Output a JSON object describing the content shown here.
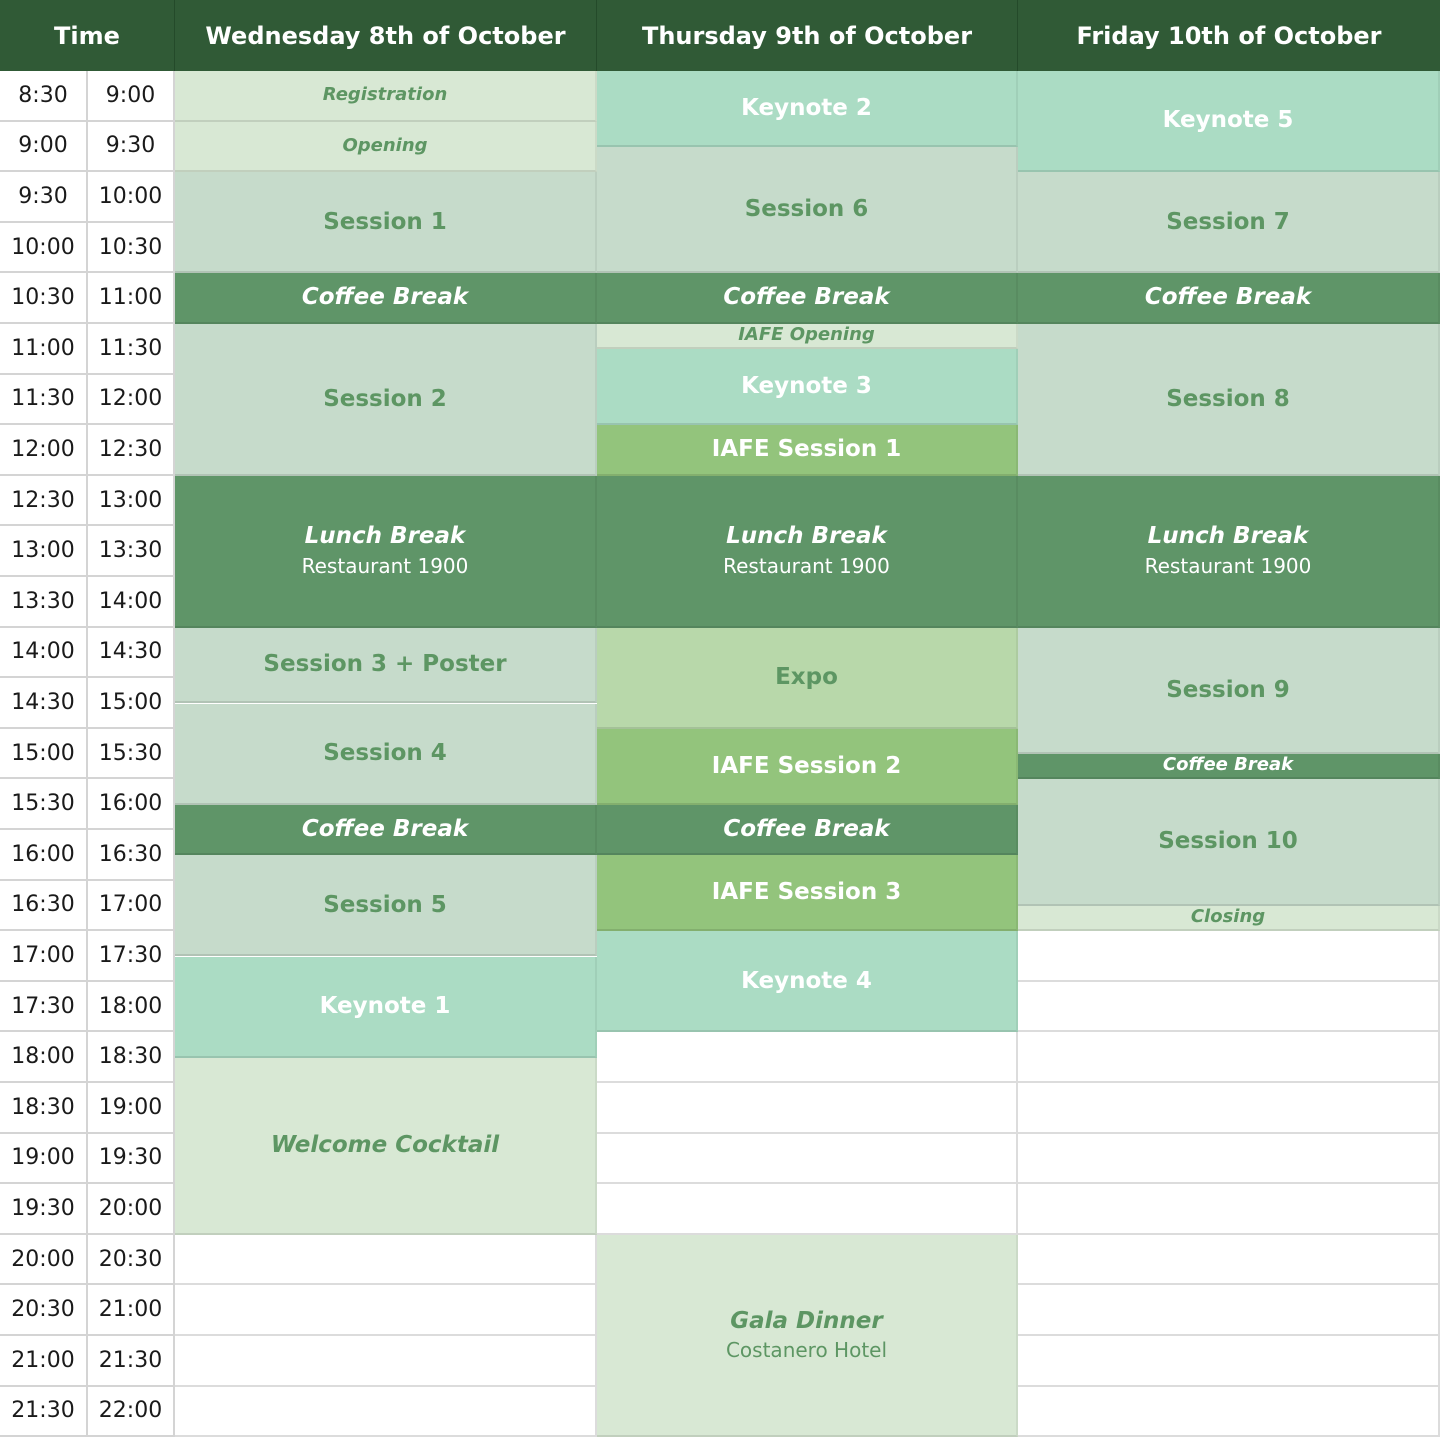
{
  "header": {
    "time_label": "Time",
    "days": [
      "Wednesday 8th of October",
      "Thursday 9th of October",
      "Friday 10th of October"
    ]
  },
  "time_slots": [
    [
      "8:30",
      "9:00"
    ],
    [
      "9:00",
      "9:30"
    ],
    [
      "9:30",
      "10:00"
    ],
    [
      "10:00",
      "10:30"
    ],
    [
      "10:30",
      "11:00"
    ],
    [
      "11:00",
      "11:30"
    ],
    [
      "11:30",
      "12:00"
    ],
    [
      "12:00",
      "12:30"
    ],
    [
      "12:30",
      "13:00"
    ],
    [
      "13:00",
      "13:30"
    ],
    [
      "13:30",
      "14:00"
    ],
    [
      "14:00",
      "14:30"
    ],
    [
      "14:30",
      "15:00"
    ],
    [
      "15:00",
      "15:30"
    ],
    [
      "15:30",
      "16:00"
    ],
    [
      "16:00",
      "16:30"
    ],
    [
      "16:30",
      "17:00"
    ],
    [
      "17:00",
      "17:30"
    ],
    [
      "17:30",
      "18:00"
    ],
    [
      "18:00",
      "18:30"
    ],
    [
      "18:30",
      "19:00"
    ],
    [
      "19:00",
      "19:30"
    ],
    [
      "19:30",
      "20:00"
    ],
    [
      "20:00",
      "20:30"
    ],
    [
      "20:30",
      "21:00"
    ],
    [
      "21:00",
      "21:30"
    ],
    [
      "21:30",
      "22:00"
    ]
  ],
  "schedule": [
    [
      {
        "title": "Registration",
        "start": "8:30",
        "end": "9:00",
        "type": "reg",
        "italic": true,
        "size": "s"
      },
      {
        "title": "Opening",
        "start": "9:00",
        "end": "9:30",
        "type": "reg",
        "italic": true,
        "size": "s"
      },
      {
        "title": "Session 1",
        "start": "9:30",
        "end": "10:30",
        "type": "sess"
      },
      {
        "title": "Coffee Break",
        "start": "10:30",
        "end": "11:00",
        "type": "coff",
        "italic": true
      },
      {
        "title": "Session 2",
        "start": "11:00",
        "end": "12:30",
        "type": "sess"
      },
      {
        "title": "Lunch Break",
        "subtitle": "Restaurant 1900",
        "start": "12:30",
        "end": "14:00",
        "type": "lunch",
        "italic": true
      },
      {
        "title": "Session 3 + Poster",
        "start": "14:00",
        "end": "14:45",
        "type": "sess"
      },
      {
        "title": "Session 4",
        "start": "14:45",
        "end": "15:45",
        "type": "sess"
      },
      {
        "title": "Coffee Break",
        "start": "15:45",
        "end": "16:15",
        "type": "coff",
        "italic": true
      },
      {
        "title": "Session 5",
        "start": "16:15",
        "end": "17:15",
        "type": "sess"
      },
      {
        "title": "Keynote 1",
        "start": "17:15",
        "end": "18:15",
        "type": "key"
      },
      {
        "title": "Welcome Cocktail",
        "start": "18:15",
        "end": "20:00",
        "type": "cock",
        "italic": true
      }
    ],
    [
      {
        "title": "Keynote 2",
        "start": "8:30",
        "end": "9:15",
        "type": "key"
      },
      {
        "title": "Session 6",
        "start": "9:15",
        "end": "10:30",
        "type": "sess"
      },
      {
        "title": "Coffee Break",
        "start": "10:30",
        "end": "11:00",
        "type": "coff",
        "italic": true
      },
      {
        "title": "IAFE Opening",
        "start": "11:00",
        "end": "11:15",
        "type": "reg",
        "italic": true,
        "size": "s"
      },
      {
        "title": "Keynote 3",
        "start": "11:15",
        "end": "12:00",
        "type": "key"
      },
      {
        "title": "IAFE Session 1",
        "start": "12:00",
        "end": "12:30",
        "type": "iafe"
      },
      {
        "title": "Lunch Break",
        "subtitle": "Restaurant 1900",
        "start": "12:30",
        "end": "14:00",
        "type": "lunch",
        "italic": true
      },
      {
        "title": "Expo",
        "start": "14:00",
        "end": "15:00",
        "type": "expo"
      },
      {
        "title": "IAFE Session 2",
        "start": "15:00",
        "end": "15:45",
        "type": "iafe"
      },
      {
        "title": "Coffee Break",
        "start": "15:45",
        "end": "16:15",
        "type": "coff",
        "italic": true
      },
      {
        "title": "IAFE Session 3",
        "start": "16:15",
        "end": "17:00",
        "type": "iafe"
      },
      {
        "title": "Keynote 4",
        "start": "17:00",
        "end": "18:00",
        "type": "key"
      },
      {
        "title": "Gala Dinner",
        "subtitle": "Costanero Hotel",
        "start": "20:00",
        "end": "22:00",
        "type": "cock",
        "italic": true
      }
    ],
    [
      {
        "title": "Keynote 5",
        "start": "8:30",
        "end": "9:30",
        "type": "key"
      },
      {
        "title": "Session 7",
        "start": "9:30",
        "end": "10:30",
        "type": "sess"
      },
      {
        "title": "Coffee Break",
        "start": "10:30",
        "end": "11:00",
        "type": "coff",
        "italic": true
      },
      {
        "title": "Session 8",
        "start": "11:00",
        "end": "12:30",
        "type": "sess"
      },
      {
        "title": "Lunch Break",
        "subtitle": "Restaurant 1900",
        "start": "12:30",
        "end": "14:00",
        "type": "lunch",
        "italic": true
      },
      {
        "title": "Session 9",
        "start": "14:00",
        "end": "15:15",
        "type": "sess"
      },
      {
        "title": "Coffee Break",
        "start": "15:15",
        "end": "15:30",
        "type": "coff",
        "italic": true,
        "size": "s"
      },
      {
        "title": "Session 10",
        "start": "15:30",
        "end": "16:45",
        "type": "sess"
      },
      {
        "title": "Closing",
        "start": "16:45",
        "end": "17:00",
        "type": "reg",
        "italic": true,
        "size": "s"
      }
    ]
  ],
  "colors": {
    "header_bg": "#305a36",
    "registration": "#d8e8d4",
    "keynote": "#abdcc4",
    "session": "#c6dbcb",
    "coffee_lunch": "#5f9568",
    "iafe": "#93c47c",
    "expo": "#b8d8aa",
    "text_green": "#5d9663"
  }
}
